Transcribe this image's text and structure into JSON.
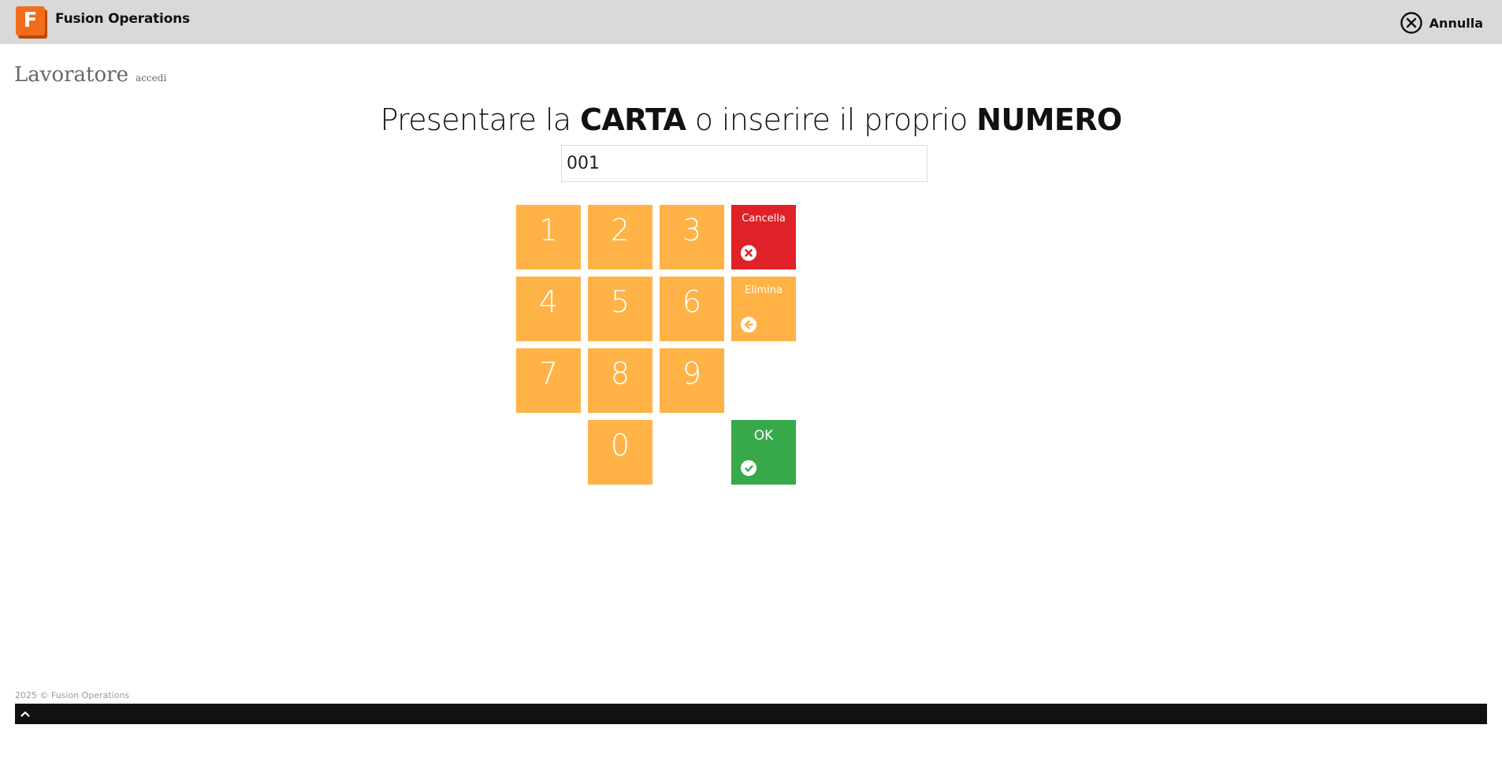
{
  "header": {
    "logo_letter": "F",
    "app_name": "Fusion Operations",
    "cancel_label": "Annulla",
    "cancel_icon": "close-circle-icon"
  },
  "page": {
    "title": "Lavoratore",
    "subtitle": "accedi"
  },
  "prompt": {
    "part1": "Presentare la ",
    "bold1": "CARTA",
    "part2": " o inserire il proprio ",
    "bold2": "NUMERO"
  },
  "input": {
    "value": "001",
    "placeholder": ""
  },
  "keypad": {
    "digits": [
      "1",
      "2",
      "3",
      "4",
      "5",
      "6",
      "7",
      "8",
      "9",
      "0"
    ],
    "clear": {
      "label": "Cancella",
      "icon": "x-circle-icon",
      "color": "#e02127"
    },
    "delete": {
      "label": "Elimina",
      "icon": "arrow-left-circle-icon",
      "color": "#ffb347"
    },
    "ok": {
      "label": "OK",
      "icon": "check-circle-icon",
      "color": "#38a94a"
    },
    "digit_color": "#ffb347"
  },
  "footer": {
    "copyright": "2025 © Fusion Operations",
    "toggle_icon": "chevron-up-icon"
  }
}
